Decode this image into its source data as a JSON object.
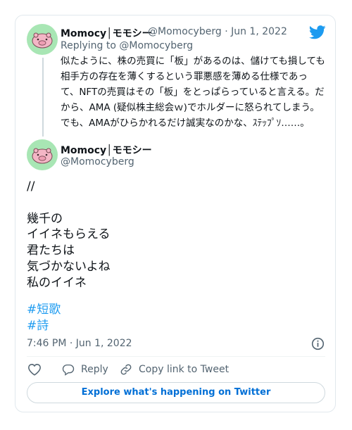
{
  "colors": {
    "accent": "#1d9bf0",
    "text": "#0f1419",
    "muted": "#536471",
    "avatar_bg": "#a8e6b4",
    "link": "#006fd6"
  },
  "parent": {
    "name": "Momocy│モモシー",
    "handle": "@Momocyberg",
    "separator": "·",
    "date": "Jun 1, 2022",
    "replying_prefix": "Replying to ",
    "replying_handle": "@Momocyberg",
    "text": "似たように、株の売買に「板」があるのは、儲けても損しても相手方の存在を薄くするという罪悪感を薄める仕様であって、NFTの売買はその「板」をとっぱらっていると言える。だから、AMA (疑似株主総会ｗ)でホルダーに怒られてしまう。でも、AMAがひらかれるだけ誠実なのかな、ｽﾃｯﾌﾟｿ……。"
  },
  "tweet": {
    "name": "Momocy│モモシー",
    "handle": "@Momocyberg",
    "text": "//\n\n幾千の\nイイネもらえる\n君たちは\n気づかないよね\n私のイイネ",
    "hashtags": [
      "#短歌",
      "#詩"
    ],
    "timestamp": "7:46 PM · Jun 1, 2022"
  },
  "actions": {
    "reply": "Reply",
    "copy_link": "Copy link to Tweet"
  },
  "explore_label": "Explore what's happening on Twitter",
  "icons": [
    "twitter-bird-icon",
    "info-icon",
    "heart-icon",
    "reply-icon",
    "link-icon"
  ]
}
